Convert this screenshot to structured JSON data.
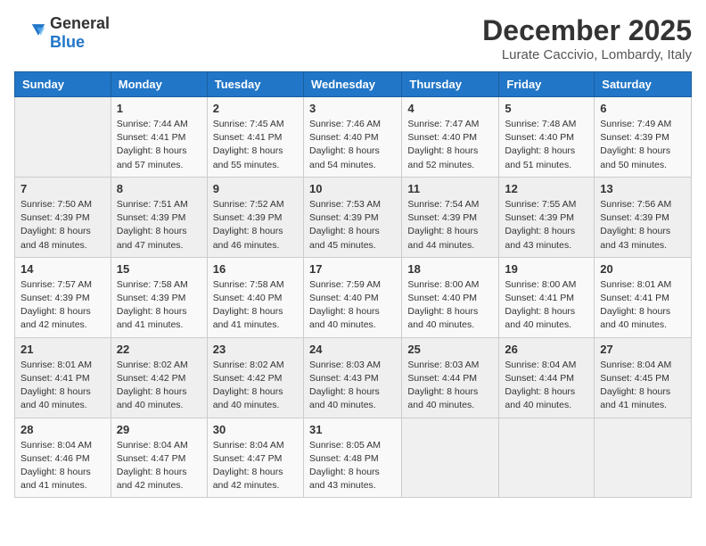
{
  "logo": {
    "general": "General",
    "blue": "Blue"
  },
  "title": "December 2025",
  "location": "Lurate Caccivio, Lombardy, Italy",
  "days_header": [
    "Sunday",
    "Monday",
    "Tuesday",
    "Wednesday",
    "Thursday",
    "Friday",
    "Saturday"
  ],
  "weeks": [
    [
      {
        "day": "",
        "sunrise": "",
        "sunset": "",
        "daylight": ""
      },
      {
        "day": "1",
        "sunrise": "Sunrise: 7:44 AM",
        "sunset": "Sunset: 4:41 PM",
        "daylight": "Daylight: 8 hours and 57 minutes."
      },
      {
        "day": "2",
        "sunrise": "Sunrise: 7:45 AM",
        "sunset": "Sunset: 4:41 PM",
        "daylight": "Daylight: 8 hours and 55 minutes."
      },
      {
        "day": "3",
        "sunrise": "Sunrise: 7:46 AM",
        "sunset": "Sunset: 4:40 PM",
        "daylight": "Daylight: 8 hours and 54 minutes."
      },
      {
        "day": "4",
        "sunrise": "Sunrise: 7:47 AM",
        "sunset": "Sunset: 4:40 PM",
        "daylight": "Daylight: 8 hours and 52 minutes."
      },
      {
        "day": "5",
        "sunrise": "Sunrise: 7:48 AM",
        "sunset": "Sunset: 4:40 PM",
        "daylight": "Daylight: 8 hours and 51 minutes."
      },
      {
        "day": "6",
        "sunrise": "Sunrise: 7:49 AM",
        "sunset": "Sunset: 4:39 PM",
        "daylight": "Daylight: 8 hours and 50 minutes."
      }
    ],
    [
      {
        "day": "7",
        "sunrise": "Sunrise: 7:50 AM",
        "sunset": "Sunset: 4:39 PM",
        "daylight": "Daylight: 8 hours and 48 minutes."
      },
      {
        "day": "8",
        "sunrise": "Sunrise: 7:51 AM",
        "sunset": "Sunset: 4:39 PM",
        "daylight": "Daylight: 8 hours and 47 minutes."
      },
      {
        "day": "9",
        "sunrise": "Sunrise: 7:52 AM",
        "sunset": "Sunset: 4:39 PM",
        "daylight": "Daylight: 8 hours and 46 minutes."
      },
      {
        "day": "10",
        "sunrise": "Sunrise: 7:53 AM",
        "sunset": "Sunset: 4:39 PM",
        "daylight": "Daylight: 8 hours and 45 minutes."
      },
      {
        "day": "11",
        "sunrise": "Sunrise: 7:54 AM",
        "sunset": "Sunset: 4:39 PM",
        "daylight": "Daylight: 8 hours and 44 minutes."
      },
      {
        "day": "12",
        "sunrise": "Sunrise: 7:55 AM",
        "sunset": "Sunset: 4:39 PM",
        "daylight": "Daylight: 8 hours and 43 minutes."
      },
      {
        "day": "13",
        "sunrise": "Sunrise: 7:56 AM",
        "sunset": "Sunset: 4:39 PM",
        "daylight": "Daylight: 8 hours and 43 minutes."
      }
    ],
    [
      {
        "day": "14",
        "sunrise": "Sunrise: 7:57 AM",
        "sunset": "Sunset: 4:39 PM",
        "daylight": "Daylight: 8 hours and 42 minutes."
      },
      {
        "day": "15",
        "sunrise": "Sunrise: 7:58 AM",
        "sunset": "Sunset: 4:39 PM",
        "daylight": "Daylight: 8 hours and 41 minutes."
      },
      {
        "day": "16",
        "sunrise": "Sunrise: 7:58 AM",
        "sunset": "Sunset: 4:40 PM",
        "daylight": "Daylight: 8 hours and 41 minutes."
      },
      {
        "day": "17",
        "sunrise": "Sunrise: 7:59 AM",
        "sunset": "Sunset: 4:40 PM",
        "daylight": "Daylight: 8 hours and 40 minutes."
      },
      {
        "day": "18",
        "sunrise": "Sunrise: 8:00 AM",
        "sunset": "Sunset: 4:40 PM",
        "daylight": "Daylight: 8 hours and 40 minutes."
      },
      {
        "day": "19",
        "sunrise": "Sunrise: 8:00 AM",
        "sunset": "Sunset: 4:41 PM",
        "daylight": "Daylight: 8 hours and 40 minutes."
      },
      {
        "day": "20",
        "sunrise": "Sunrise: 8:01 AM",
        "sunset": "Sunset: 4:41 PM",
        "daylight": "Daylight: 8 hours and 40 minutes."
      }
    ],
    [
      {
        "day": "21",
        "sunrise": "Sunrise: 8:01 AM",
        "sunset": "Sunset: 4:41 PM",
        "daylight": "Daylight: 8 hours and 40 minutes."
      },
      {
        "day": "22",
        "sunrise": "Sunrise: 8:02 AM",
        "sunset": "Sunset: 4:42 PM",
        "daylight": "Daylight: 8 hours and 40 minutes."
      },
      {
        "day": "23",
        "sunrise": "Sunrise: 8:02 AM",
        "sunset": "Sunset: 4:42 PM",
        "daylight": "Daylight: 8 hours and 40 minutes."
      },
      {
        "day": "24",
        "sunrise": "Sunrise: 8:03 AM",
        "sunset": "Sunset: 4:43 PM",
        "daylight": "Daylight: 8 hours and 40 minutes."
      },
      {
        "day": "25",
        "sunrise": "Sunrise: 8:03 AM",
        "sunset": "Sunset: 4:44 PM",
        "daylight": "Daylight: 8 hours and 40 minutes."
      },
      {
        "day": "26",
        "sunrise": "Sunrise: 8:04 AM",
        "sunset": "Sunset: 4:44 PM",
        "daylight": "Daylight: 8 hours and 40 minutes."
      },
      {
        "day": "27",
        "sunrise": "Sunrise: 8:04 AM",
        "sunset": "Sunset: 4:45 PM",
        "daylight": "Daylight: 8 hours and 41 minutes."
      }
    ],
    [
      {
        "day": "28",
        "sunrise": "Sunrise: 8:04 AM",
        "sunset": "Sunset: 4:46 PM",
        "daylight": "Daylight: 8 hours and 41 minutes."
      },
      {
        "day": "29",
        "sunrise": "Sunrise: 8:04 AM",
        "sunset": "Sunset: 4:47 PM",
        "daylight": "Daylight: 8 hours and 42 minutes."
      },
      {
        "day": "30",
        "sunrise": "Sunrise: 8:04 AM",
        "sunset": "Sunset: 4:47 PM",
        "daylight": "Daylight: 8 hours and 42 minutes."
      },
      {
        "day": "31",
        "sunrise": "Sunrise: 8:05 AM",
        "sunset": "Sunset: 4:48 PM",
        "daylight": "Daylight: 8 hours and 43 minutes."
      },
      {
        "day": "",
        "sunrise": "",
        "sunset": "",
        "daylight": ""
      },
      {
        "day": "",
        "sunrise": "",
        "sunset": "",
        "daylight": ""
      },
      {
        "day": "",
        "sunrise": "",
        "sunset": "",
        "daylight": ""
      }
    ]
  ]
}
